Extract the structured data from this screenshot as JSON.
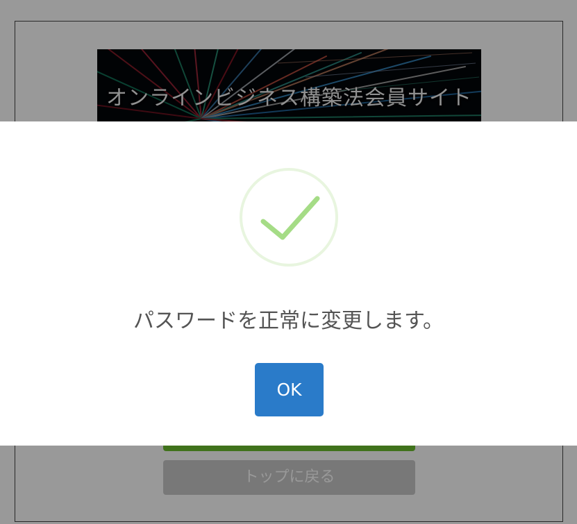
{
  "background": {
    "banner_title": "オンラインビジネス構築法会員サイト",
    "back_button_label": "トップに戻る"
  },
  "modal": {
    "icon": "success-checkmark-icon",
    "message": "パスワードを正常に変更します。",
    "ok_label": "OK"
  },
  "colors": {
    "ok_button": "#2a7bc9",
    "checkmark": "#a5dc86",
    "change_button": "#6bbf2d",
    "overlay": "rgba(0,0,0,0.4)"
  }
}
